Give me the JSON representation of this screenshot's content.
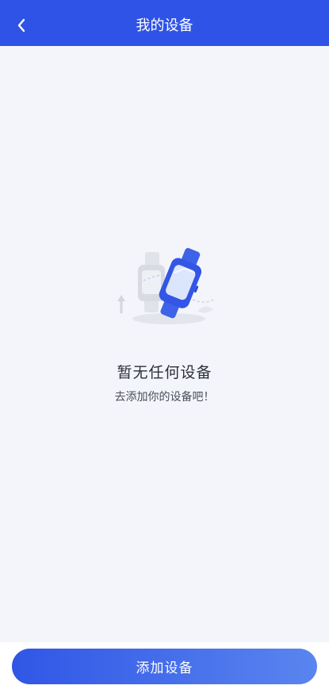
{
  "header": {
    "title": "我的设备",
    "back_icon": "chevron-left-icon"
  },
  "empty_state": {
    "illustration_icon": "smartwatch-icon",
    "title": "暂无任何设备",
    "subtitle": "去添加你的设备吧！"
  },
  "footer": {
    "add_button_label": "添加设备"
  },
  "colors": {
    "primary": "#2f53e6",
    "background": "#f4f5fa"
  }
}
